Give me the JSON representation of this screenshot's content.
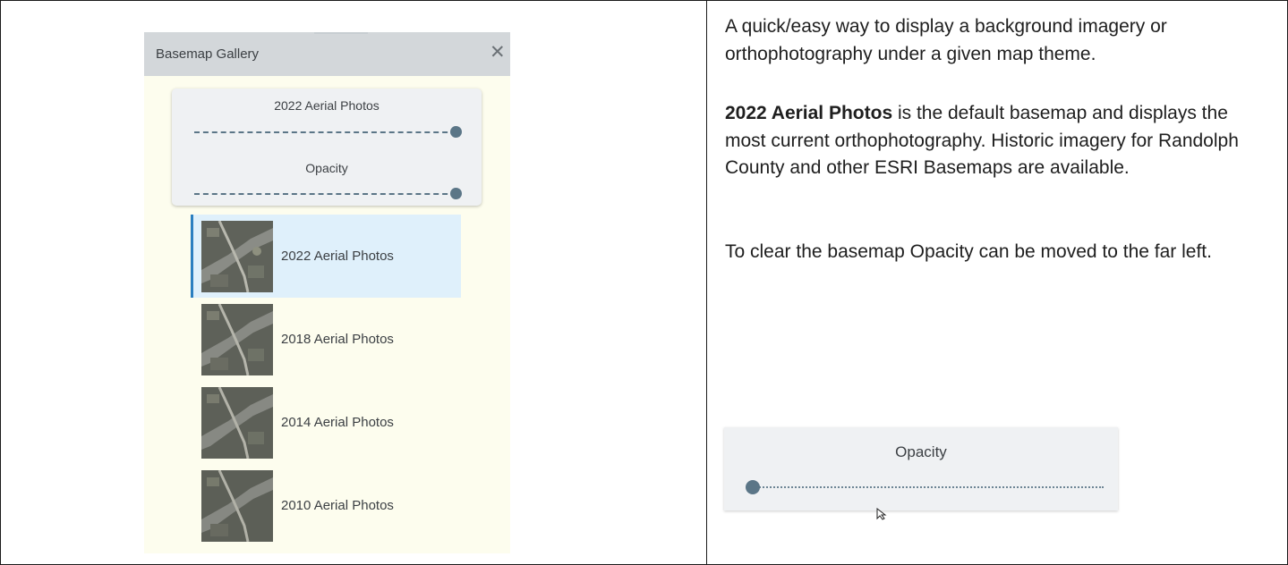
{
  "gallery": {
    "title": "Basemap Gallery",
    "close_icon": "close-icon",
    "active_layer_label": "2022 Aerial Photos",
    "opacity_label": "Opacity",
    "active_layer_slider_fraction": 1.0,
    "opacity_slider_fraction": 1.0,
    "items": [
      {
        "label": "2022 Aerial Photos",
        "selected": true
      },
      {
        "label": "2018 Aerial Photos",
        "selected": false
      },
      {
        "label": "2014 Aerial Photos",
        "selected": false
      },
      {
        "label": "2010 Aerial Photos",
        "selected": false
      }
    ]
  },
  "description": {
    "para1": "A quick/easy way to display a background imagery or orthophotography under a given map theme.",
    "para2_bold": "2022 Aerial Photos",
    "para2_rest": " is the default basemap and displays the most current orthophotography.  Historic imagery for Randolph County and other ESRI Basemaps are available.",
    "para3": "To clear the basemap Opacity can be moved to the far left."
  },
  "opacity_example": {
    "label": "Opacity",
    "slider_fraction": 0.0
  },
  "colors": {
    "selected_accent": "#2b7fc0",
    "slider": "#5b7687",
    "panel_bg": "#fdfdee"
  }
}
